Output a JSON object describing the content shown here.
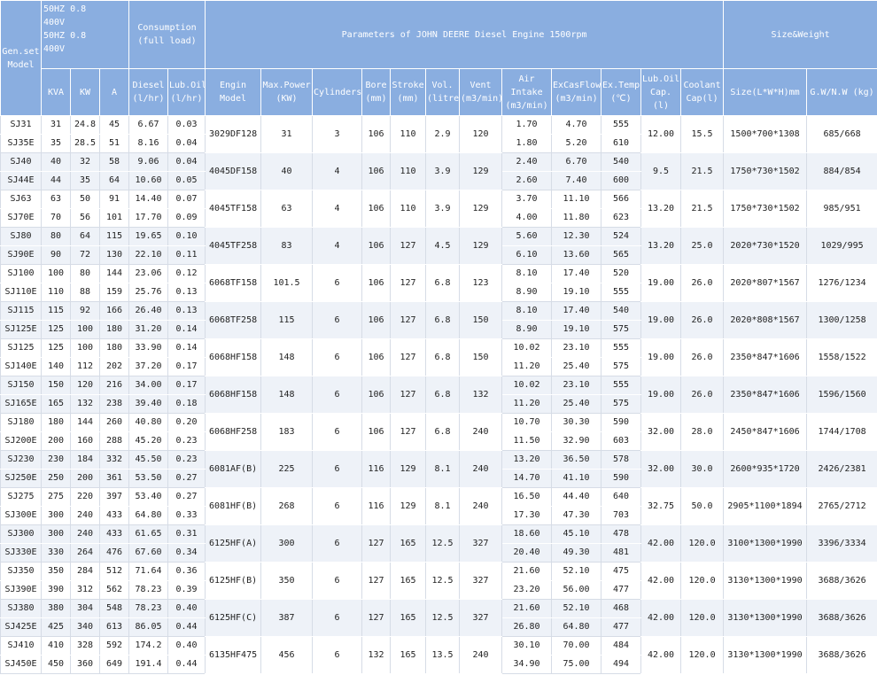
{
  "header": {
    "genset_model": "Gen.set Model",
    "freq_lines": [
      "50HZ 0.8",
      "400V",
      "50HZ 0.8",
      "400V"
    ],
    "consumption": "Consumption (full load)",
    "engine_params": "Parameters of JOHN DEERE Diesel Engine 1500rpm",
    "size_weight": "Size&Weight",
    "columns": [
      "KVA",
      "KW",
      "A",
      "Diesel (l/hr)",
      "Lub.Oil (l/hr)",
      "Engin Model",
      "Max.Power (KW)",
      "Cylinders",
      "Bore (mm)",
      "Stroke (mm)",
      "Vol. (litre)",
      "Vent (m3/min)",
      "Air Intake (m3/min)",
      "ExCasFlow (m3/min)",
      "Ex.Temp (℃)",
      "Lub.Oil Cap.(l)",
      "Coolant Cap(l)",
      "Size(L*W*H)mm",
      "G.W/N.W (kg)"
    ]
  },
  "rows": [
    {
      "a": {
        "model": "SJ31",
        "kva": "31",
        "kw": "24.8",
        "amp": "45",
        "diesel": "6.67",
        "lub": "0.03",
        "air": "1.70",
        "exflow": "4.70",
        "extemp": "555"
      },
      "b": {
        "model": "SJ35E",
        "kva": "35",
        "kw": "28.5",
        "amp": "51",
        "diesel": "8.16",
        "lub": "0.04",
        "air": "1.80",
        "exflow": "5.20",
        "extemp": "610"
      },
      "engine": "3029DF128",
      "maxpower": "31",
      "cyl": "3",
      "bore": "106",
      "stroke": "110",
      "vol": "2.9",
      "vent": "120",
      "lubcap": "12.00",
      "coolant": "15.5",
      "size": "1500*700*1308",
      "weight": "685/668"
    },
    {
      "a": {
        "model": "SJ40",
        "kva": "40",
        "kw": "32",
        "amp": "58",
        "diesel": "9.06",
        "lub": "0.04",
        "air": "2.40",
        "exflow": "6.70",
        "extemp": "540"
      },
      "b": {
        "model": "SJ44E",
        "kva": "44",
        "kw": "35",
        "amp": "64",
        "diesel": "10.60",
        "lub": "0.05",
        "air": "2.60",
        "exflow": "7.40",
        "extemp": "600"
      },
      "engine": "4045DF158",
      "maxpower": "40",
      "cyl": "4",
      "bore": "106",
      "stroke": "110",
      "vol": "3.9",
      "vent": "129",
      "lubcap": "9.5",
      "coolant": "21.5",
      "size": "1750*730*1502",
      "weight": "884/854"
    },
    {
      "a": {
        "model": "SJ63",
        "kva": "63",
        "kw": "50",
        "amp": "91",
        "diesel": "14.40",
        "lub": "0.07",
        "air": "3.70",
        "exflow": "11.10",
        "extemp": "566"
      },
      "b": {
        "model": "SJ70E",
        "kva": "70",
        "kw": "56",
        "amp": "101",
        "diesel": "17.70",
        "lub": "0.09",
        "air": "4.00",
        "exflow": "11.80",
        "extemp": "623"
      },
      "engine": "4045TF158",
      "maxpower": "63",
      "cyl": "4",
      "bore": "106",
      "stroke": "110",
      "vol": "3.9",
      "vent": "129",
      "lubcap": "13.20",
      "coolant": "21.5",
      "size": "1750*730*1502",
      "weight": "985/951"
    },
    {
      "a": {
        "model": "SJ80",
        "kva": "80",
        "kw": "64",
        "amp": "115",
        "diesel": "19.65",
        "lub": "0.10",
        "air": "5.60",
        "exflow": "12.30",
        "extemp": "524"
      },
      "b": {
        "model": "SJ90E",
        "kva": "90",
        "kw": "72",
        "amp": "130",
        "diesel": "22.10",
        "lub": "0.11",
        "air": "6.10",
        "exflow": "13.60",
        "extemp": "565"
      },
      "engine": "4045TF258",
      "maxpower": "83",
      "cyl": "4",
      "bore": "106",
      "stroke": "127",
      "vol": "4.5",
      "vent": "129",
      "lubcap": "13.20",
      "coolant": "25.0",
      "size": "2020*730*1520",
      "weight": "1029/995"
    },
    {
      "a": {
        "model": "SJ100",
        "kva": "100",
        "kw": "80",
        "amp": "144",
        "diesel": "23.06",
        "lub": "0.12",
        "air": "8.10",
        "exflow": "17.40",
        "extemp": "520"
      },
      "b": {
        "model": "SJ110E",
        "kva": "110",
        "kw": "88",
        "amp": "159",
        "diesel": "25.76",
        "lub": "0.13",
        "air": "8.90",
        "exflow": "19.10",
        "extemp": "555"
      },
      "engine": "6068TF158",
      "maxpower": "101.5",
      "cyl": "6",
      "bore": "106",
      "stroke": "127",
      "vol": "6.8",
      "vent": "123",
      "lubcap": "19.00",
      "coolant": "26.0",
      "size": "2020*807*1567",
      "weight": "1276/1234"
    },
    {
      "a": {
        "model": "SJ115",
        "kva": "115",
        "kw": "92",
        "amp": "166",
        "diesel": "26.40",
        "lub": "0.13",
        "air": "8.10",
        "exflow": "17.40",
        "extemp": "540"
      },
      "b": {
        "model": "SJ125E",
        "kva": "125",
        "kw": "100",
        "amp": "180",
        "diesel": "31.20",
        "lub": "0.14",
        "air": "8.90",
        "exflow": "19.10",
        "extemp": "575"
      },
      "engine": "6068TF258",
      "maxpower": "115",
      "cyl": "6",
      "bore": "106",
      "stroke": "127",
      "vol": "6.8",
      "vent": "150",
      "lubcap": "19.00",
      "coolant": "26.0",
      "size": "2020*808*1567",
      "weight": "1300/1258"
    },
    {
      "a": {
        "model": "SJ125",
        "kva": "125",
        "kw": "100",
        "amp": "180",
        "diesel": "33.90",
        "lub": "0.14",
        "air": "10.02",
        "exflow": "23.10",
        "extemp": "555"
      },
      "b": {
        "model": "SJ140E",
        "kva": "140",
        "kw": "112",
        "amp": "202",
        "diesel": "37.20",
        "lub": "0.17",
        "air": "11.20",
        "exflow": "25.40",
        "extemp": "575"
      },
      "engine": "6068HF158",
      "maxpower": "148",
      "cyl": "6",
      "bore": "106",
      "stroke": "127",
      "vol": "6.8",
      "vent": "150",
      "lubcap": "19.00",
      "coolant": "26.0",
      "size": "2350*847*1606",
      "weight": "1558/1522"
    },
    {
      "a": {
        "model": "SJ150",
        "kva": "150",
        "kw": "120",
        "amp": "216",
        "diesel": "34.00",
        "lub": "0.17",
        "air": "10.02",
        "exflow": "23.10",
        "extemp": "555"
      },
      "b": {
        "model": "SJ165E",
        "kva": "165",
        "kw": "132",
        "amp": "238",
        "diesel": "39.40",
        "lub": "0.18",
        "air": "11.20",
        "exflow": "25.40",
        "extemp": "575"
      },
      "engine": "6068HF158",
      "maxpower": "148",
      "cyl": "6",
      "bore": "106",
      "stroke": "127",
      "vol": "6.8",
      "vent": "132",
      "lubcap": "19.00",
      "coolant": "26.0",
      "size": "2350*847*1606",
      "weight": "1596/1560"
    },
    {
      "a": {
        "model": "SJ180",
        "kva": "180",
        "kw": "144",
        "amp": "260",
        "diesel": "40.80",
        "lub": "0.20",
        "air": "10.70",
        "exflow": "30.30",
        "extemp": "590"
      },
      "b": {
        "model": "SJ200E",
        "kva": "200",
        "kw": "160",
        "amp": "288",
        "diesel": "45.20",
        "lub": "0.23",
        "air": "11.50",
        "exflow": "32.90",
        "extemp": "603"
      },
      "engine": "6068HF258",
      "maxpower": "183",
      "cyl": "6",
      "bore": "106",
      "stroke": "127",
      "vol": "6.8",
      "vent": "240",
      "lubcap": "32.00",
      "coolant": "28.0",
      "size": "2450*847*1606",
      "weight": "1744/1708"
    },
    {
      "a": {
        "model": "SJ230",
        "kva": "230",
        "kw": "184",
        "amp": "332",
        "diesel": "45.50",
        "lub": "0.23",
        "air": "13.20",
        "exflow": "36.50",
        "extemp": "578"
      },
      "b": {
        "model": "SJ250E",
        "kva": "250",
        "kw": "200",
        "amp": "361",
        "diesel": "53.50",
        "lub": "0.27",
        "air": "14.70",
        "exflow": "41.10",
        "extemp": "590"
      },
      "engine": "6081AF(B)",
      "maxpower": "225",
      "cyl": "6",
      "bore": "116",
      "stroke": "129",
      "vol": "8.1",
      "vent": "240",
      "lubcap": "32.00",
      "coolant": "30.0",
      "size": "2600*935*1720",
      "weight": "2426/2381"
    },
    {
      "a": {
        "model": "SJ275",
        "kva": "275",
        "kw": "220",
        "amp": "397",
        "diesel": "53.40",
        "lub": "0.27",
        "air": "16.50",
        "exflow": "44.40",
        "extemp": "640"
      },
      "b": {
        "model": "SJ300E",
        "kva": "300",
        "kw": "240",
        "amp": "433",
        "diesel": "64.80",
        "lub": "0.33",
        "air": "17.30",
        "exflow": "47.30",
        "extemp": "703"
      },
      "engine": "6081HF(B)",
      "maxpower": "268",
      "cyl": "6",
      "bore": "116",
      "stroke": "129",
      "vol": "8.1",
      "vent": "240",
      "lubcap": "32.75",
      "coolant": "50.0",
      "size": "2905*1100*1894",
      "weight": "2765/2712"
    },
    {
      "a": {
        "model": "SJ300",
        "kva": "300",
        "kw": "240",
        "amp": "433",
        "diesel": "61.65",
        "lub": "0.31",
        "air": "18.60",
        "exflow": "45.10",
        "extemp": "478"
      },
      "b": {
        "model": "SJ330E",
        "kva": "330",
        "kw": "264",
        "amp": "476",
        "diesel": "67.60",
        "lub": "0.34",
        "air": "20.40",
        "exflow": "49.30",
        "extemp": "481"
      },
      "engine": "6125HF(A)",
      "maxpower": "300",
      "cyl": "6",
      "bore": "127",
      "stroke": "165",
      "vol": "12.5",
      "vent": "327",
      "lubcap": "42.00",
      "coolant": "120.0",
      "size": "3100*1300*1990",
      "weight": "3396/3334"
    },
    {
      "a": {
        "model": "SJ350",
        "kva": "350",
        "kw": "284",
        "amp": "512",
        "diesel": "71.64",
        "lub": "0.36",
        "air": "21.60",
        "exflow": "52.10",
        "extemp": "475"
      },
      "b": {
        "model": "SJ390E",
        "kva": "390",
        "kw": "312",
        "amp": "562",
        "diesel": "78.23",
        "lub": "0.39",
        "air": "23.20",
        "exflow": "56.00",
        "extemp": "477"
      },
      "engine": "6125HF(B)",
      "maxpower": "350",
      "cyl": "6",
      "bore": "127",
      "stroke": "165",
      "vol": "12.5",
      "vent": "327",
      "lubcap": "42.00",
      "coolant": "120.0",
      "size": "3130*1300*1990",
      "weight": "3688/3626"
    },
    {
      "a": {
        "model": "SJ380",
        "kva": "380",
        "kw": "304",
        "amp": "548",
        "diesel": "78.23",
        "lub": "0.40",
        "air": "21.60",
        "exflow": "52.10",
        "extemp": "468"
      },
      "b": {
        "model": "SJ425E",
        "kva": "425",
        "kw": "340",
        "amp": "613",
        "diesel": "86.05",
        "lub": "0.44",
        "air": "26.80",
        "exflow": "64.80",
        "extemp": "477"
      },
      "engine": "6125HF(C)",
      "maxpower": "387",
      "cyl": "6",
      "bore": "127",
      "stroke": "165",
      "vol": "12.5",
      "vent": "327",
      "lubcap": "42.00",
      "coolant": "120.0",
      "size": "3130*1300*1990",
      "weight": "3688/3626"
    },
    {
      "a": {
        "model": "SJ410",
        "kva": "410",
        "kw": "328",
        "amp": "592",
        "diesel": "174.2",
        "lub": "0.40",
        "air": "30.10",
        "exflow": "70.00",
        "extemp": "484"
      },
      "b": {
        "model": "SJ450E",
        "kva": "450",
        "kw": "360",
        "amp": "649",
        "diesel": "191.4",
        "lub": "0.44",
        "air": "34.90",
        "exflow": "75.00",
        "extemp": "494"
      },
      "engine": "6135HF475",
      "maxpower": "456",
      "cyl": "6",
      "bore": "132",
      "stroke": "165",
      "vol": "13.5",
      "vent": "240",
      "lubcap": "42.00",
      "coolant": "120.0",
      "size": "3130*1300*1990",
      "weight": "3688/3626"
    }
  ]
}
